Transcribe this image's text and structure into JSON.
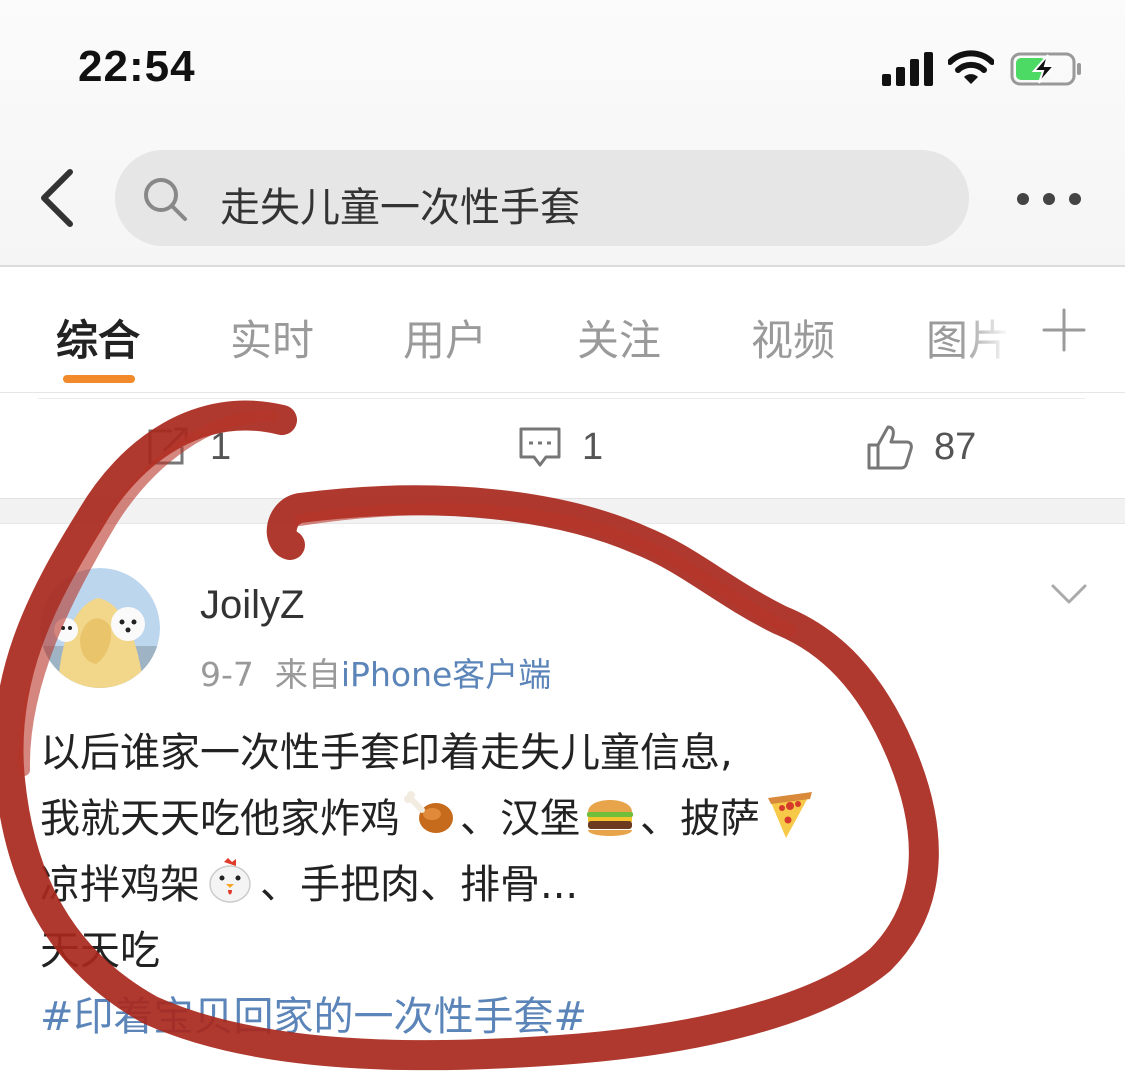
{
  "status_bar": {
    "time": "22:54",
    "icons": [
      "signal-icon",
      "wifi-icon",
      "battery-charging-icon"
    ],
    "battery_color": "#4cd964"
  },
  "search": {
    "query": "走失儿童一次性手套",
    "back_icon": "chevron-left-icon",
    "search_icon": "search-icon",
    "more_icon": "more-dots-icon"
  },
  "tabs": [
    {
      "label": "综合",
      "active": true
    },
    {
      "label": "实时",
      "active": false
    },
    {
      "label": "用户",
      "active": false
    },
    {
      "label": "关注",
      "active": false
    },
    {
      "label": "视频",
      "active": false
    },
    {
      "label": "图片",
      "active": false
    }
  ],
  "tab_add_icon": "plus-icon",
  "accent_color": "#f28a2b",
  "previous_post_actions": {
    "repost_count": "1",
    "comment_count": "1",
    "like_count": "87"
  },
  "post": {
    "username": "JoilyZ",
    "date": "9-7",
    "source_prefix": "来自",
    "source": "iPhone客户端",
    "lines": [
      "以后谁家一次性手套印着走失儿童信息,",
      "我就天天吃他家炸鸡",
      "、汉堡",
      "、披萨",
      "凉拌鸡架",
      "、手把肉、排骨...",
      "天天吃"
    ],
    "hashtag": "#印着宝贝回家的一次性手套#",
    "link_color": "#5b84b8"
  },
  "annotation_color": "#a8281c"
}
